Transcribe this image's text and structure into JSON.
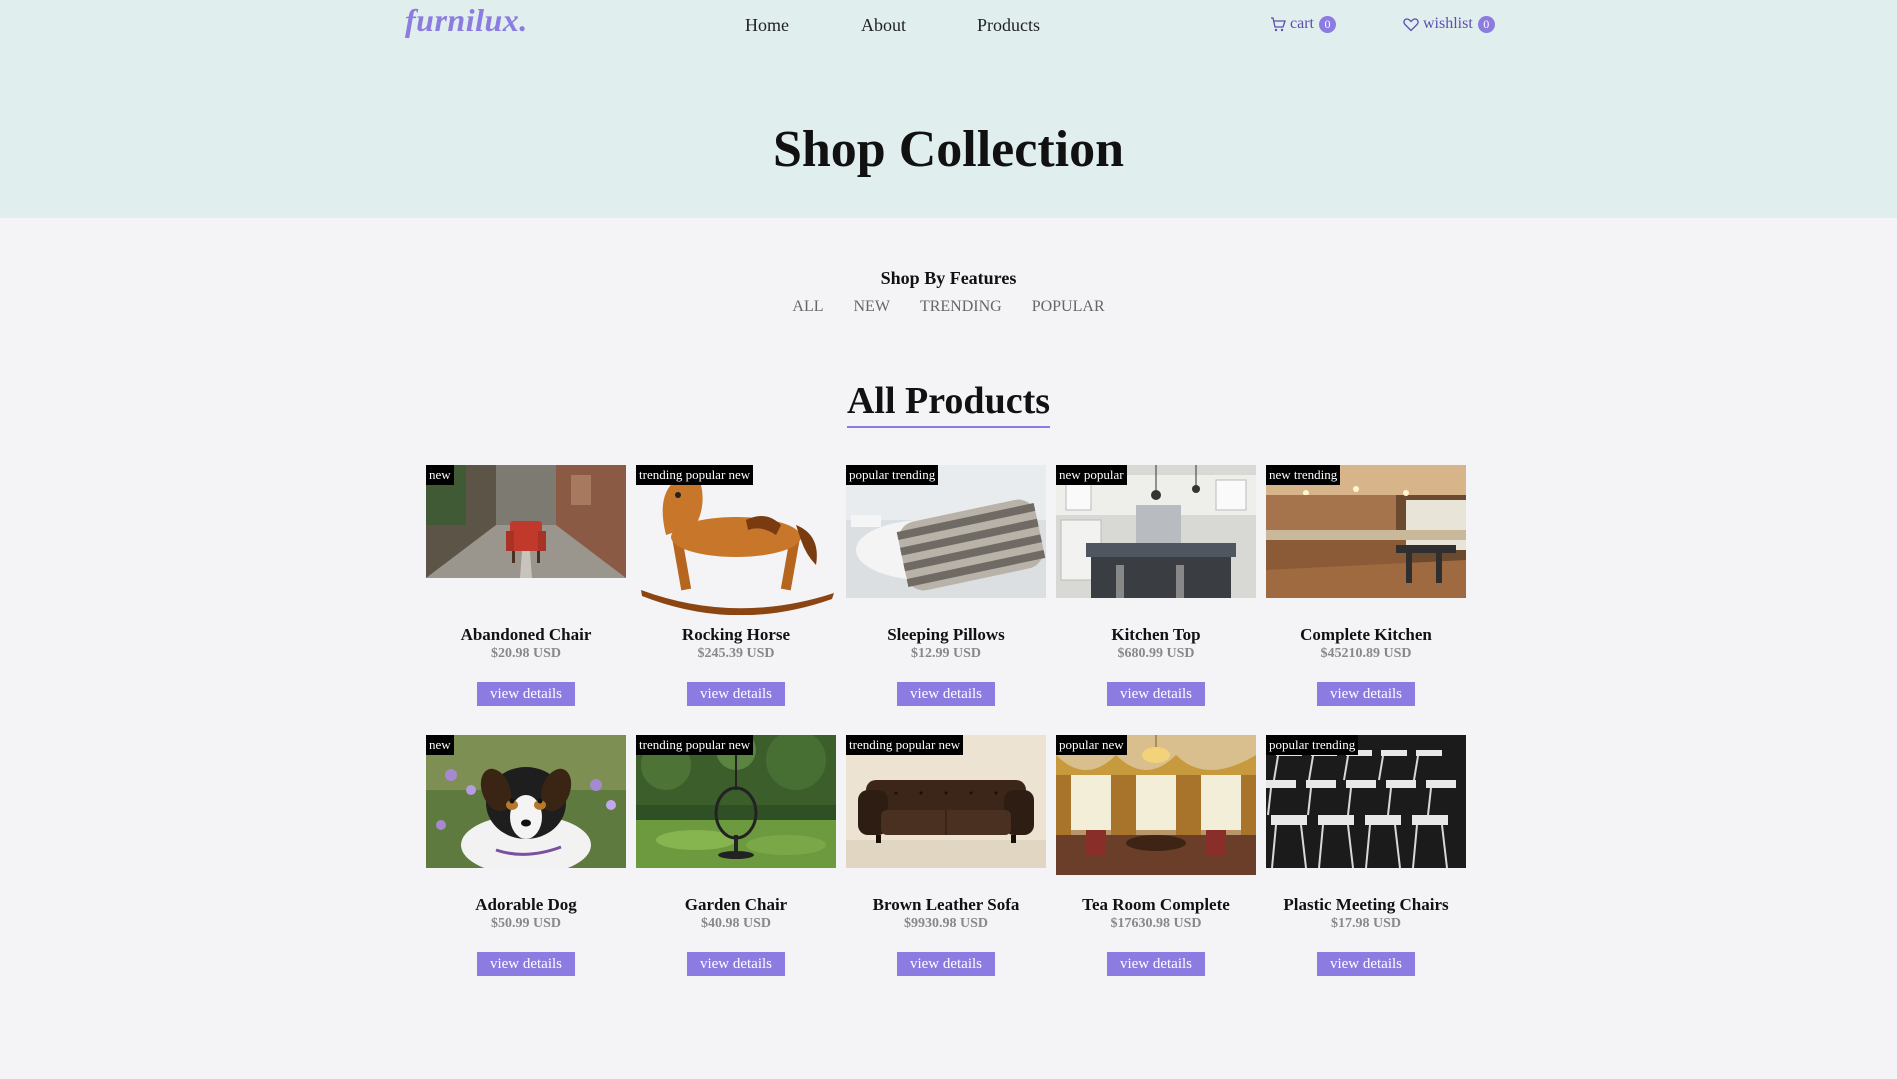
{
  "brand": {
    "logo": "furnilux."
  },
  "nav": {
    "links": [
      "Home",
      "About",
      "Products"
    ],
    "cart": {
      "label": "cart",
      "count": "0",
      "icon": "cart-icon"
    },
    "wishlist": {
      "label": "wishlist",
      "count": "0",
      "icon": "heart-icon"
    }
  },
  "hero": {
    "title": "Shop Collection"
  },
  "features": {
    "title": "Shop By Features",
    "filters": [
      "ALL",
      "NEW",
      "TRENDING",
      "POPULAR"
    ]
  },
  "section": {
    "title": "All Products"
  },
  "colors": {
    "accent": "#8c7be0",
    "hero_bg": "#e0eeee",
    "page_bg": "#f4f4f6",
    "tag_bg": "#000000"
  },
  "products": [
    {
      "tags": "new",
      "name": "Abandoned Chair",
      "price": "$20.98 USD",
      "button": "view details",
      "image": "red-armchair-street-photo"
    },
    {
      "tags": "trending popular new",
      "name": "Rocking Horse",
      "price": "$245.39 USD",
      "button": "view details",
      "image": "wooden-rocking-horse-photo"
    },
    {
      "tags": "popular trending",
      "name": "Sleeping Pillows",
      "price": "$12.99 USD",
      "button": "view details",
      "image": "striped-pillows-photo"
    },
    {
      "tags": "new popular",
      "name": "Kitchen Top",
      "price": "$680.99 USD",
      "button": "view details",
      "image": "kitchen-island-photo"
    },
    {
      "tags": "new trending",
      "name": "Complete Kitchen",
      "price": "$45210.89 USD",
      "button": "view details",
      "image": "wooden-kitchen-photo"
    },
    {
      "tags": "new",
      "name": "Adorable Dog",
      "price": "$50.99 USD",
      "button": "view details",
      "image": "dog-in-flowers-photo"
    },
    {
      "tags": "trending popular new",
      "name": "Garden Chair",
      "price": "$40.98 USD",
      "button": "view details",
      "image": "hanging-garden-chair-photo"
    },
    {
      "tags": "trending popular new",
      "name": "Brown Leather Sofa",
      "price": "$9930.98 USD",
      "button": "view details",
      "image": "leather-sofa-photo"
    },
    {
      "tags": "popular new",
      "name": "Tea Room Complete",
      "price": "$17630.98 USD",
      "button": "view details",
      "image": "tea-room-photo"
    },
    {
      "tags": "popular trending",
      "name": "Plastic Meeting Chairs",
      "price": "$17.98 USD",
      "button": "view details",
      "image": "folding-chairs-photo"
    }
  ]
}
